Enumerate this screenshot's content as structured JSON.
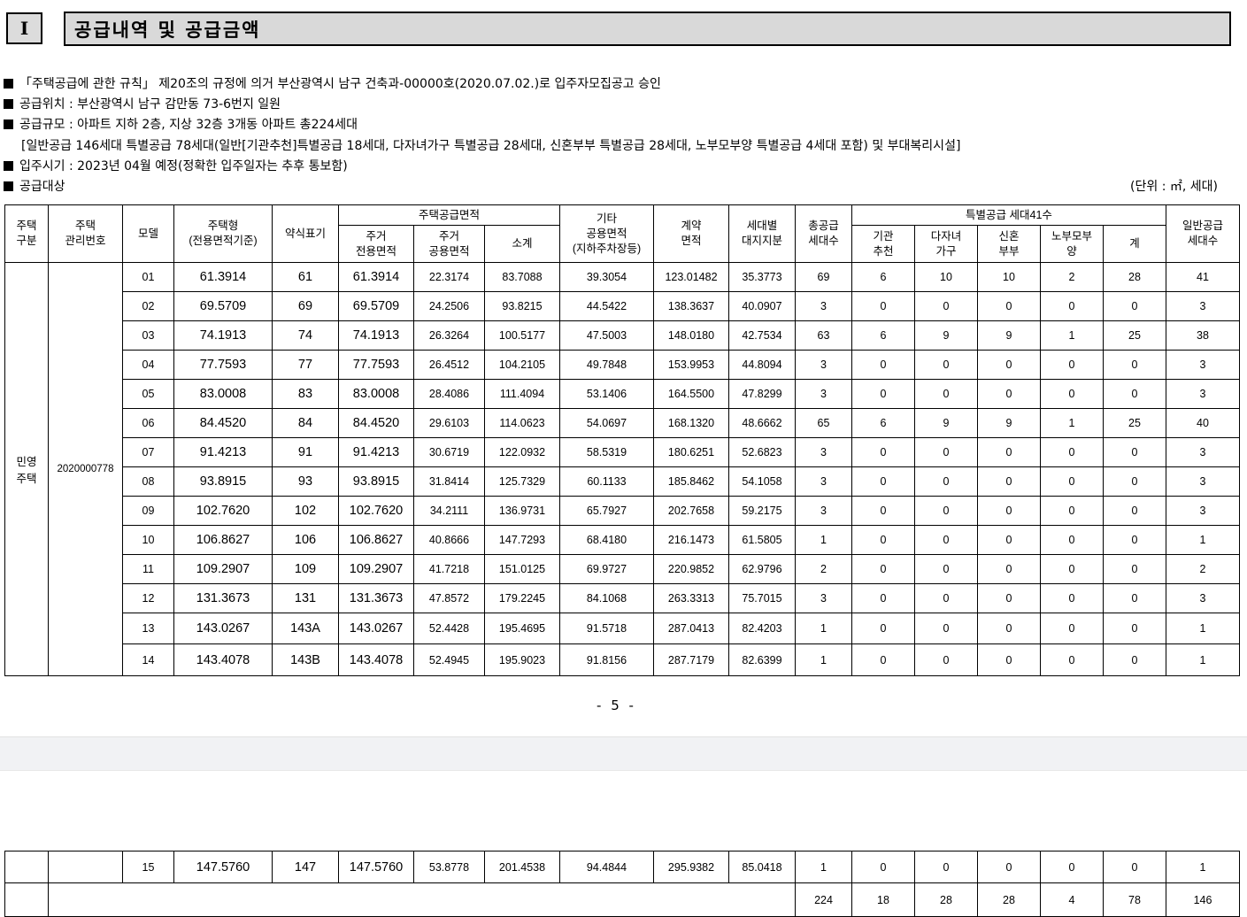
{
  "section": {
    "number": "I",
    "title": "공급내역 및 공급금액"
  },
  "notes": [
    "「주택공급에 관한 규칙」 제20조의 규정에 의거 부산광역시 남구 건축과-00000호(2020.07.02.)로 입주자모집공고 승인",
    "공급위치 : 부산광역시 남구 감만동 73-6번지 일원",
    "공급규모 : 아파트 지하 2층, 지상 32층 3개동 아파트 총224세대",
    "[일반공급 146세대 특별공급 78세대(일반[기관추천]특별공급 18세대, 다자녀가구 특별공급 28세대, 신혼부부 특별공급 28세대, 노부모부양 특별공급 4세대 포함) 및 부대복리시설]",
    "입주시기 : 2023년 04월 예정(정확한 입주일자는 추후 통보함)",
    "공급대상"
  ],
  "unit": "(단위 : ㎡, 세대)",
  "headers": {
    "type": "주택\n구분",
    "mgmt_no": "주택\n관리번호",
    "model": "모델",
    "housing_type": "주택형\n(전용면적기준)",
    "abbr": "약식표기",
    "area_group": "주택공급면적",
    "exclusive": "주거\n전용면적",
    "common": "주거\n공용면적",
    "subtotal": "소계",
    "other_common": "기타\n공용면적\n(지하주차장등)",
    "contract": "계약\n면적",
    "land_share": "세대별\n대지지분",
    "total_supply": "총공급\n세대수",
    "special_group": "특별공급 세대41수",
    "institution": "기관\n추천",
    "multi_child": "다자녀\n가구",
    "newlywed": "신혼\n부부",
    "elderly": "노부모부\n양",
    "special_total": "계",
    "general": "일반공급\n세대수"
  },
  "group": {
    "type": "민영\n주택",
    "mgmt_no": "2020000778"
  },
  "rows": [
    {
      "model": "01",
      "type": "61.3914",
      "abbr": "61",
      "exclusive": "61.3914",
      "common": "22.3174",
      "subtotal": "83.7088",
      "other": "39.3054",
      "contract": "123.01482",
      "land": "35.3773",
      "total": "69",
      "inst": "6",
      "multi": "10",
      "newly": "10",
      "elder": "2",
      "sp_total": "28",
      "general": "41"
    },
    {
      "model": "02",
      "type": "69.5709",
      "abbr": "69",
      "exclusive": "69.5709",
      "common": "24.2506",
      "subtotal": "93.8215",
      "other": "44.5422",
      "contract": "138.3637",
      "land": "40.0907",
      "total": "3",
      "inst": "0",
      "multi": "0",
      "newly": "0",
      "elder": "0",
      "sp_total": "0",
      "general": "3"
    },
    {
      "model": "03",
      "type": "74.1913",
      "abbr": "74",
      "exclusive": "74.1913",
      "common": "26.3264",
      "subtotal": "100.5177",
      "other": "47.5003",
      "contract": "148.0180",
      "land": "42.7534",
      "total": "63",
      "inst": "6",
      "multi": "9",
      "newly": "9",
      "elder": "1",
      "sp_total": "25",
      "general": "38"
    },
    {
      "model": "04",
      "type": "77.7593",
      "abbr": "77",
      "exclusive": "77.7593",
      "common": "26.4512",
      "subtotal": "104.2105",
      "other": "49.7848",
      "contract": "153.9953",
      "land": "44.8094",
      "total": "3",
      "inst": "0",
      "multi": "0",
      "newly": "0",
      "elder": "0",
      "sp_total": "0",
      "general": "3"
    },
    {
      "model": "05",
      "type": "83.0008",
      "abbr": "83",
      "exclusive": "83.0008",
      "common": "28.4086",
      "subtotal": "111.4094",
      "other": "53.1406",
      "contract": "164.5500",
      "land": "47.8299",
      "total": "3",
      "inst": "0",
      "multi": "0",
      "newly": "0",
      "elder": "0",
      "sp_total": "0",
      "general": "3"
    },
    {
      "model": "06",
      "type": "84.4520",
      "abbr": "84",
      "exclusive": "84.4520",
      "common": "29.6103",
      "subtotal": "114.0623",
      "other": "54.0697",
      "contract": "168.1320",
      "land": "48.6662",
      "total": "65",
      "inst": "6",
      "multi": "9",
      "newly": "9",
      "elder": "1",
      "sp_total": "25",
      "general": "40"
    },
    {
      "model": "07",
      "type": "91.4213",
      "abbr": "91",
      "exclusive": "91.4213",
      "common": "30.6719",
      "subtotal": "122.0932",
      "other": "58.5319",
      "contract": "180.6251",
      "land": "52.6823",
      "total": "3",
      "inst": "0",
      "multi": "0",
      "newly": "0",
      "elder": "0",
      "sp_total": "0",
      "general": "3"
    },
    {
      "model": "08",
      "type": "93.8915",
      "abbr": "93",
      "exclusive": "93.8915",
      "common": "31.8414",
      "subtotal": "125.7329",
      "other": "60.1133",
      "contract": "185.8462",
      "land": "54.1058",
      "total": "3",
      "inst": "0",
      "multi": "0",
      "newly": "0",
      "elder": "0",
      "sp_total": "0",
      "general": "3"
    },
    {
      "model": "09",
      "type": "102.7620",
      "abbr": "102",
      "exclusive": "102.7620",
      "common": "34.2111",
      "subtotal": "136.9731",
      "other": "65.7927",
      "contract": "202.7658",
      "land": "59.2175",
      "total": "3",
      "inst": "0",
      "multi": "0",
      "newly": "0",
      "elder": "0",
      "sp_total": "0",
      "general": "3"
    },
    {
      "model": "10",
      "type": "106.8627",
      "abbr": "106",
      "exclusive": "106.8627",
      "common": "40.8666",
      "subtotal": "147.7293",
      "other": "68.4180",
      "contract": "216.1473",
      "land": "61.5805",
      "total": "1",
      "inst": "0",
      "multi": "0",
      "newly": "0",
      "elder": "0",
      "sp_total": "0",
      "general": "1"
    },
    {
      "model": "11",
      "type": "109.2907",
      "abbr": "109",
      "exclusive": "109.2907",
      "common": "41.7218",
      "subtotal": "151.0125",
      "other": "69.9727",
      "contract": "220.9852",
      "land": "62.9796",
      "total": "2",
      "inst": "0",
      "multi": "0",
      "newly": "0",
      "elder": "0",
      "sp_total": "0",
      "general": "2"
    },
    {
      "model": "12",
      "type": "131.3673",
      "abbr": "131",
      "exclusive": "131.3673",
      "common": "47.8572",
      "subtotal": "179.2245",
      "other": "84.1068",
      "contract": "263.3313",
      "land": "75.7015",
      "total": "3",
      "inst": "0",
      "multi": "0",
      "newly": "0",
      "elder": "0",
      "sp_total": "0",
      "general": "3"
    },
    {
      "model": "13",
      "type": "143.0267",
      "abbr": "143A",
      "exclusive": "143.0267",
      "common": "52.4428",
      "subtotal": "195.4695",
      "other": "91.5718",
      "contract": "287.0413",
      "land": "82.4203",
      "total": "1",
      "inst": "0",
      "multi": "0",
      "newly": "0",
      "elder": "0",
      "sp_total": "0",
      "general": "1"
    },
    {
      "model": "14",
      "type": "143.4078",
      "abbr": "143B",
      "exclusive": "143.4078",
      "common": "52.4945",
      "subtotal": "195.9023",
      "other": "91.8156",
      "contract": "287.7179",
      "land": "82.6399",
      "total": "1",
      "inst": "0",
      "multi": "0",
      "newly": "0",
      "elder": "0",
      "sp_total": "0",
      "general": "1"
    }
  ],
  "page_number": "- 5 -",
  "continued": {
    "row": {
      "model": "15",
      "type": "147.5760",
      "abbr": "147",
      "exclusive": "147.5760",
      "common": "53.8778",
      "subtotal": "201.4538",
      "other": "94.4844",
      "contract": "295.9382",
      "land": "85.0418",
      "total": "1",
      "inst": "0",
      "multi": "0",
      "newly": "0",
      "elder": "0",
      "sp_total": "0",
      "general": "1"
    },
    "totals": {
      "total": "224",
      "inst": "18",
      "multi": "28",
      "newly": "28",
      "elder": "4",
      "sp_total": "78",
      "general": "146"
    }
  }
}
